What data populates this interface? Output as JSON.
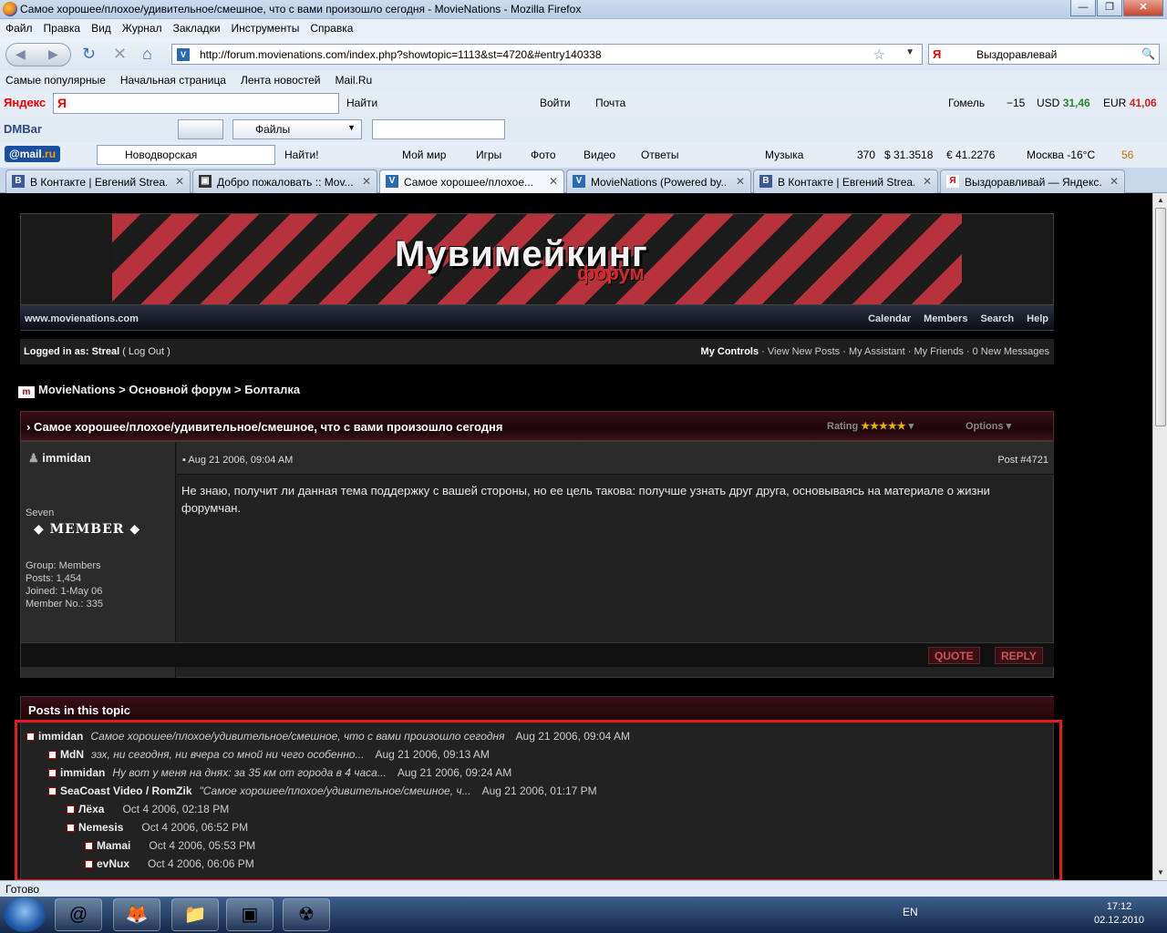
{
  "window": {
    "title": "Самое хорошее/плохое/удивительное/смешное, что с вами произошло сегодня - MovieNations - Mozilla Firefox"
  },
  "menu": [
    "Файл",
    "Правка",
    "Вид",
    "Журнал",
    "Закладки",
    "Инструменты",
    "Справка"
  ],
  "nav": {
    "url": "http://forum.movienations.com/index.php?showtopic=1113&st=4720&#entry140338",
    "search_value": "Выздоравлевай",
    "search_engine": "Я"
  },
  "bookmarks": [
    "Самые популярные",
    "Начальная страница",
    "Лента новостей",
    "Mail.Ru"
  ],
  "yandex_bar": {
    "logo": "Яндекс",
    "input_logo": "Я",
    "find": "Найти",
    "login": "Войти",
    "mail": "Почта",
    "city": "Гомель",
    "temp": "−15",
    "usd_label": "USD",
    "usd_value": "31,46",
    "eur_label": "EUR",
    "eur_value": "41,06"
  },
  "dm_bar": {
    "logo": "DMBar",
    "files": "Файлы"
  },
  "mail_bar": {
    "logo_a": "@mail",
    "logo_b": ".ru",
    "location": "Новодворская",
    "find": "Найти!",
    "items": [
      "Мой мир",
      "Игры",
      "Фото",
      "Видео",
      "Ответы"
    ],
    "music": "Музыка",
    "mail_count": "370",
    "usd": "$ 31.3518",
    "eur": "€ 41.2276",
    "weather": "Москва -16°C",
    "traffic": "56"
  },
  "tabs": [
    {
      "label": "В Контакте | Евгений Strea...",
      "icon": "B",
      "color": "#3b5998",
      "active": false
    },
    {
      "label": "Добро пожаловать :: Mov...",
      "icon": "▣",
      "color": "#333",
      "active": false
    },
    {
      "label": "Самое хорошее/плохое...",
      "icon": "V",
      "color": "#2a6ab5",
      "active": true
    },
    {
      "label": "MovieNations (Powered by...",
      "icon": "V",
      "color": "#2a6ab5",
      "active": false
    },
    {
      "label": "В Контакте | Евгений Strea...",
      "icon": "B",
      "color": "#3b5998",
      "active": false
    },
    {
      "label": "Выздоравливай — Яндекс...",
      "icon": "Я",
      "color": "#e00",
      "active": false
    }
  ],
  "forum": {
    "banner_title": "Мувимейкинг",
    "banner_sub": "форум",
    "site": "www.movienations.com",
    "top_links": [
      "Calendar",
      "Members",
      "Search",
      "Help"
    ],
    "logged_label": "Logged in as:",
    "logged_user": "Streal",
    "logout": "( Log Out )",
    "user_links_bold": "My Controls",
    "user_links": "· View New Posts · My Assistant · My Friends · 0 New Messages",
    "breadcrumb": "MovieNations > Основной форум > Болталка",
    "topic_title": "Самое хорошее/плохое/удивительное/смешное, что с вами произошло сегодня",
    "rating_label": "Rating",
    "rating_stars": "★★★★★",
    "options_label": "Options",
    "post": {
      "author": "immidan",
      "date": "Aug 21 2006, 09:04 AM",
      "number": "Post #4721",
      "title_line": "Seven",
      "rank": "MEMBER",
      "group": "Group: Members",
      "posts": "Posts: 1,454",
      "joined": "Joined: 1-May 06",
      "member_no": "Member No.: 335",
      "body": "Не знаю, получит ли данная тема поддержку с вашей стороны, но ее цель такова: получше узнать друг друга, основываясь на материале о жизни форумчан.",
      "quote": "QUOTE",
      "reply": "REPLY"
    },
    "posts_header": "Posts in this topic",
    "tree": [
      {
        "name": "immidan",
        "desc": "Самое хорошее/плохое/удивительное/смешное, что с вами произошло сегодня",
        "time": "Aug 21 2006, 09:04 AM"
      },
      {
        "name": "MdN",
        "desc": "ээх, ни сегодня, ни вчера со мной ни чего особенно...",
        "time": "Aug 21 2006, 09:13 AM"
      },
      {
        "name": "immidan",
        "desc": "Ну вот у меня на днях: за 35 км от города в 4 часа...",
        "time": "Aug 21 2006, 09:24 AM"
      },
      {
        "name": "SeaCoast Video / RomZik",
        "desc": "\"Самое хорошее/плохое/удивительное/смешное, ч...",
        "time": "Aug 21 2006, 01:17 PM"
      },
      {
        "name": "Лёха",
        "desc": "",
        "time": "Oct 4 2006, 02:18 PM"
      },
      {
        "name": "Nemesis",
        "desc": "",
        "time": "Oct 4 2006, 06:52 PM"
      },
      {
        "name": "Mamai",
        "desc": "",
        "time": "Oct 4 2006, 05:53 PM"
      },
      {
        "name": "evNux",
        "desc": "",
        "time": "Oct 4 2006, 06:06 PM"
      }
    ]
  },
  "status": "Готово",
  "taskbar": {
    "lang": "EN",
    "time": "17:12",
    "date": "02.12.2010"
  }
}
